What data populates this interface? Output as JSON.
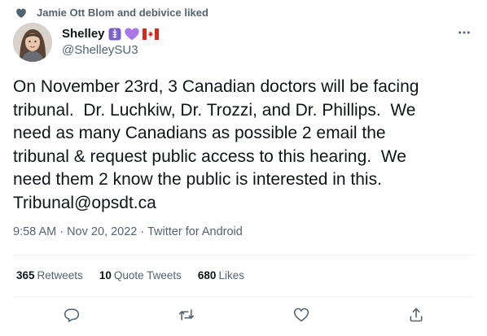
{
  "social_context": {
    "text": "Jamie Ott Blom and debivice liked"
  },
  "author": {
    "display_name": "Shelley",
    "handle": "@ShelleySU3",
    "emojis": [
      "medical-symbol",
      "purple-heart",
      "canada-flag"
    ]
  },
  "tweet": {
    "text": "On November 23rd, 3 Canadian doctors will be facing\ntribunal.  Dr. Luchkiw, Dr. Trozzi, and Dr. Phillips.  We\nneed as many Canadians as possible 2 email the\ntribunal & request public access to this hearing.  We\nneed them 2 know the public is interested in this.\nTribunal@opsdt.ca",
    "meta": "9:58 AM · Nov 20, 2022 · Twitter for Android"
  },
  "stats": {
    "retweets_count": "365",
    "retweets_label": "Retweets",
    "quotes_count": "10",
    "quotes_label": "Quote Tweets",
    "likes_count": "680",
    "likes_label": "Likes"
  },
  "icons": {
    "like_context": "heart-icon",
    "more": "more-icon",
    "reply": "reply-icon",
    "retweet": "retweet-icon",
    "like": "like-icon",
    "share": "share-icon"
  },
  "colors": {
    "primary_text": "#0f1419",
    "secondary_text": "#536471",
    "divider": "#eff3f4",
    "medical_badge": "#7b61c9",
    "purple_heart": "#aa78e6",
    "canada_red": "#d52b1e"
  }
}
